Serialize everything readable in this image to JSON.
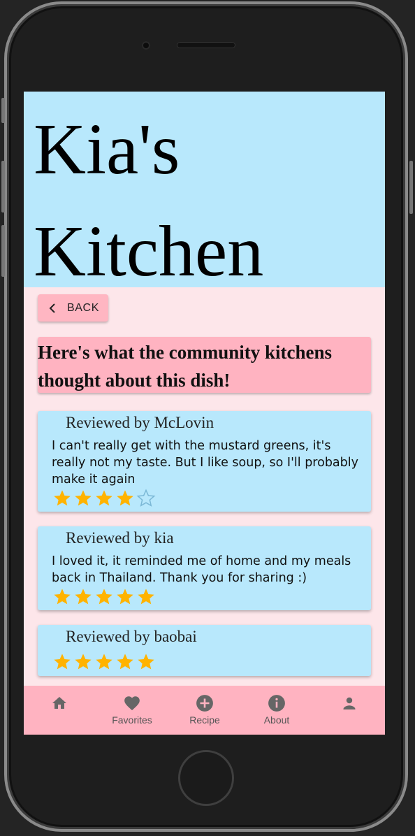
{
  "app": {
    "title_line1": "Kia's",
    "title_line2": "Kitchen"
  },
  "nav_back": {
    "label": "BACK"
  },
  "banner": {
    "line1": "Here's what the community kitchens",
    "line2": "thought about this dish!"
  },
  "reviews": [
    {
      "reviewer": "Reviewed by McLovin",
      "text": "I can't really get with the mustard greens, it's really not my taste. But I like soup, so I'll probably make it again",
      "rating": 4,
      "max_rating": 5
    },
    {
      "reviewer": "Reviewed by kia",
      "text": "I loved it, it reminded me of home and my meals back in Thailand. Thank you for sharing :)",
      "rating": 5,
      "max_rating": 5
    },
    {
      "reviewer": "Reviewed by baobai",
      "text": "",
      "rating": 5,
      "max_rating": 5
    }
  ],
  "bottom_nav": {
    "items": [
      {
        "icon": "home-icon",
        "label": ""
      },
      {
        "icon": "heart-icon",
        "label": "Favorites"
      },
      {
        "icon": "plus-circle-icon",
        "label": "Recipe"
      },
      {
        "icon": "info-icon",
        "label": "About"
      },
      {
        "icon": "person-icon",
        "label": ""
      }
    ]
  },
  "colors": {
    "header_bg": "#b8e8fc",
    "page_bg": "#fde6ea",
    "accent_pink": "#ffb3c1",
    "star_filled": "#ffb300",
    "star_empty": "#7bb8d6",
    "nav_icon": "#666666"
  }
}
